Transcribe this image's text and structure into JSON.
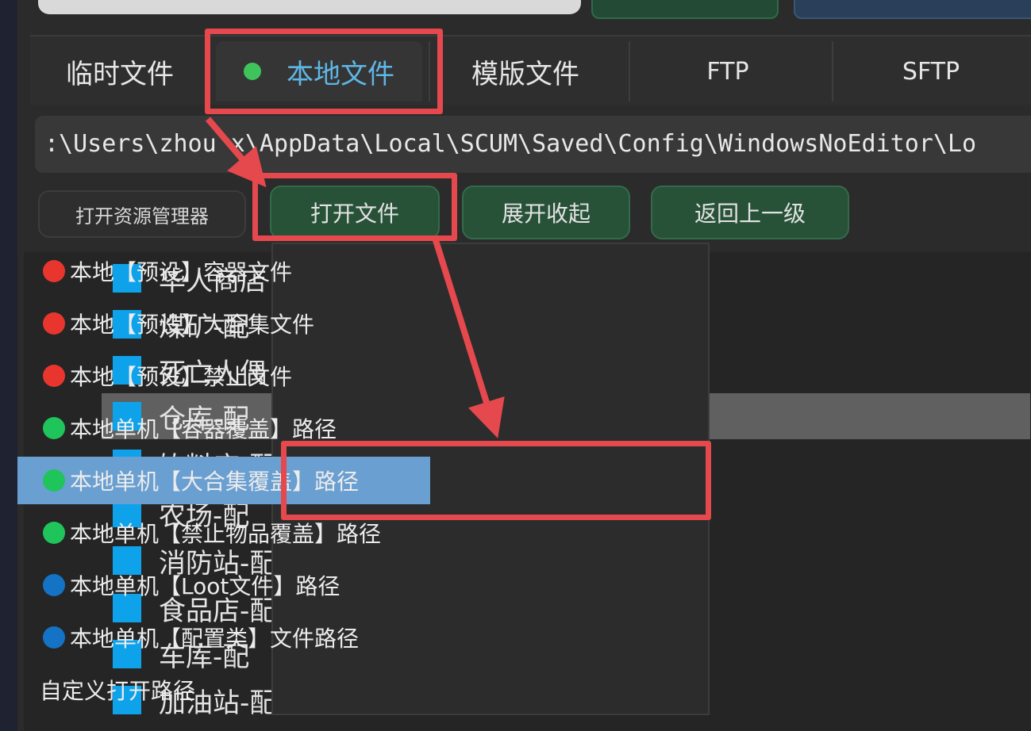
{
  "tabs": [
    {
      "label": "临时文件",
      "active": false
    },
    {
      "label": "本地文件",
      "active": true,
      "status_color": "#3ec45a"
    },
    {
      "label": "模版文件",
      "active": false
    },
    {
      "label": "FTP",
      "active": false
    },
    {
      "label": "SFTP",
      "active": false
    }
  ],
  "path": {
    "value": ":\\Users\\zhou x\\AppData\\Local\\SCUM\\Saved\\Config\\WindowsNoEditor\\Lo"
  },
  "toolbar": {
    "open_explorer": "打开资源管理器",
    "open_file": "打开文件",
    "expand_collapse": "展开收起",
    "go_up": "返回上一级"
  },
  "file_tree": {
    "items": [
      {
        "label": "华人商店",
        "selected": false
      },
      {
        "label": "煤矿-配",
        "selected": false
      },
      {
        "label": "死亡人偶",
        "selected": false
      },
      {
        "label": "仓库-配",
        "selected": true
      },
      {
        "label": "饮料店-配",
        "selected": false
      },
      {
        "label": "农场-配",
        "selected": false
      },
      {
        "label": "消防站-配",
        "selected": false
      },
      {
        "label": "食品店-配",
        "selected": false
      },
      {
        "label": "车库-配",
        "selected": false
      },
      {
        "label": "加油站-配",
        "selected": false
      }
    ]
  },
  "open_file_menu": {
    "items": [
      {
        "label": "本地【预设】容器文件",
        "dot_color": "#e8362f"
      },
      {
        "label": "本地【预设】大合集文件",
        "dot_color": "#e8362f"
      },
      {
        "label": "本地【预设】禁止文件",
        "dot_color": "#e8362f"
      },
      {
        "label": "本地单机【容器覆盖】路径",
        "dot_color": "#1fc45a"
      },
      {
        "label": "本地单机【大合集覆盖】路径",
        "dot_color": "#1fc45a",
        "highlighted": true
      },
      {
        "label": "本地单机【禁止物品覆盖】路径",
        "dot_color": "#1fc45a"
      },
      {
        "label": "本地单机【Loot文件】路径",
        "dot_color": "#1473c4"
      },
      {
        "label": "本地单机【配置类】文件路径",
        "dot_color": "#1473c4"
      },
      {
        "label": "自定义打开路径",
        "dot_color": null
      }
    ]
  },
  "colors": {
    "annotation": "#e5484d",
    "accent_blue": "#5fb6e6",
    "folder_icon": "#0ea2eb",
    "menu_highlight": "#6a9fd1"
  }
}
